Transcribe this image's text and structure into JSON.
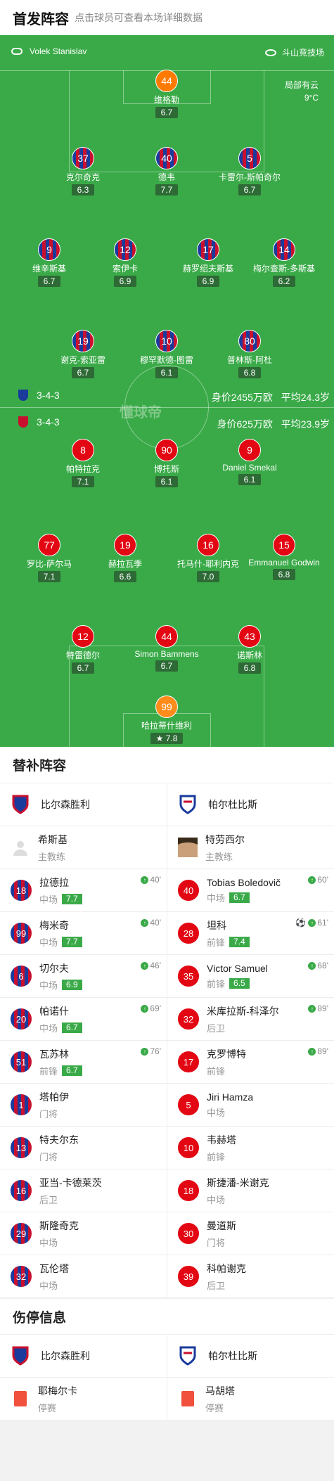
{
  "header": {
    "title": "首发阵容",
    "subtitle": "点击球员可查看本场详细数据"
  },
  "pitch": {
    "referee": "Volek Stanislav",
    "stadium": "斗山竞技场",
    "weather": "局部有云",
    "temperature": "9°C",
    "watermark": "懂球帝",
    "home": {
      "formation": "3-4-3",
      "value": "身价2455万欧",
      "age": "平均24.3岁"
    },
    "away": {
      "formation": "3-4-3",
      "value": "身价625万欧",
      "age": "平均23.9岁"
    },
    "players": [
      {
        "n": "44",
        "name": "维格勒",
        "r": "6.7",
        "c": "gk1"
      },
      {
        "n": "37",
        "name": "克尔奇克",
        "r": "6.3",
        "c": "home"
      },
      {
        "n": "40",
        "name": "德韦",
        "r": "7.7",
        "c": "home"
      },
      {
        "n": "5",
        "name": "卡雷尔-斯帕奇尔",
        "r": "6.7",
        "c": "home",
        "sub": "40'"
      },
      {
        "n": "9",
        "name": "维辛斯基",
        "r": "6.7",
        "c": "home"
      },
      {
        "n": "12",
        "name": "索伊卡",
        "r": "6.9",
        "c": "home",
        "sub": "46'"
      },
      {
        "n": "17",
        "name": "赫罗绍夫斯基",
        "r": "6.9",
        "c": "home",
        "y": 1
      },
      {
        "n": "14",
        "name": "梅尔查斯-多斯基",
        "r": "6.2",
        "c": "home",
        "red": 1
      },
      {
        "n": "19",
        "name": "谢克-索亚雷",
        "r": "6.7",
        "c": "home",
        "sub": "76'"
      },
      {
        "n": "10",
        "name": "穆罕默德-图雷",
        "r": "6.1",
        "c": "home",
        "sub": "69'"
      },
      {
        "n": "80",
        "name": "普林斯-阿杜",
        "r": "6.8",
        "c": "home",
        "sub": "40'"
      },
      {
        "n": "8",
        "name": "帕特拉克",
        "r": "7.1",
        "c": "away",
        "sub": "68'",
        "y": 1
      },
      {
        "n": "90",
        "name": "博托斯",
        "r": "6.1",
        "c": "away",
        "sub": "61'"
      },
      {
        "n": "9",
        "name": "Daniel Smekal",
        "r": "6.1",
        "c": "away",
        "sub": "89'"
      },
      {
        "n": "77",
        "name": "罗比-萨尔马",
        "r": "7.1",
        "c": "away",
        "sub": "60'"
      },
      {
        "n": "19",
        "name": "赫拉瓦季",
        "r": "6.6",
        "c": "away"
      },
      {
        "n": "16",
        "name": "托马什-耶利内克",
        "r": "7.0",
        "c": "away",
        "ball": 1
      },
      {
        "n": "15",
        "name": "Emmanuel Godwin",
        "r": "6.8",
        "c": "away",
        "yc": 1
      },
      {
        "n": "12",
        "name": "特雷德尔",
        "r": "6.7",
        "c": "away",
        "sub": "89'",
        "yy": 1
      },
      {
        "n": "44",
        "name": "Simon Bammens",
        "r": "6.7",
        "c": "away"
      },
      {
        "n": "43",
        "name": "诺斯林",
        "r": "6.8",
        "c": "away"
      },
      {
        "n": "99",
        "name": "哈拉蒂什维利",
        "r": "7.8",
        "c": "gk2",
        "star": 1
      }
    ]
  },
  "subs": {
    "title": "替补阵容",
    "home_team": "比尔森胜利",
    "away_team": "帕尔杜比斯",
    "home_coach": {
      "name": "希斯基",
      "role": "主教练"
    },
    "away_coach": {
      "name": "特劳西尔",
      "role": "主教练"
    },
    "home": [
      {
        "n": "18",
        "name": "拉德拉",
        "pos": "中场",
        "r": "7.7",
        "t": "40'"
      },
      {
        "n": "99",
        "name": "梅米奇",
        "pos": "中场",
        "r": "7.7",
        "t": "40'"
      },
      {
        "n": "6",
        "name": "切尔夫",
        "pos": "中场",
        "r": "6.9",
        "t": "46'"
      },
      {
        "n": "20",
        "name": "帕诺什",
        "pos": "中场",
        "r": "6.7",
        "t": "69'"
      },
      {
        "n": "51",
        "name": "瓦苏林",
        "pos": "前锋",
        "r": "6.7",
        "t": "76'"
      },
      {
        "n": "1",
        "name": "塔帕伊",
        "pos": "门将"
      },
      {
        "n": "13",
        "name": "特夫尔东",
        "pos": "门将"
      },
      {
        "n": "16",
        "name": "亚当-卡德莱茨",
        "pos": "后卫"
      },
      {
        "n": "29",
        "name": "斯隆奇克",
        "pos": "中场"
      },
      {
        "n": "32",
        "name": "瓦伦塔",
        "pos": "中场"
      }
    ],
    "away": [
      {
        "n": "40",
        "name": "Tobias Boledovič",
        "pos": "中场",
        "r": "6.7",
        "t": "60'"
      },
      {
        "n": "28",
        "name": "坦科",
        "pos": "前锋",
        "r": "7.4",
        "t": "61'",
        "goal": 1
      },
      {
        "n": "35",
        "name": "Victor Samuel",
        "pos": "前锋",
        "r": "6.5",
        "t": "68'"
      },
      {
        "n": "32",
        "name": "米库拉斯-科泽尔",
        "pos": "后卫",
        "t": "89'"
      },
      {
        "n": "17",
        "name": "克罗博特",
        "pos": "前锋",
        "t": "89'"
      },
      {
        "n": "5",
        "name": "Jiri Hamza",
        "pos": "中场"
      },
      {
        "n": "10",
        "name": "韦赫塔",
        "pos": "前锋"
      },
      {
        "n": "18",
        "name": "斯捷潘-米谢克",
        "pos": "中场"
      },
      {
        "n": "30",
        "name": "曼道斯",
        "pos": "门将"
      },
      {
        "n": "39",
        "name": "科帕谢克",
        "pos": "后卫"
      }
    ]
  },
  "injury": {
    "title": "伤停信息",
    "home_team": "比尔森胜利",
    "away_team": "帕尔杜比斯",
    "home": {
      "name": "耶梅尔卡",
      "status": "停赛"
    },
    "away": {
      "name": "马胡塔",
      "status": "停赛"
    }
  }
}
